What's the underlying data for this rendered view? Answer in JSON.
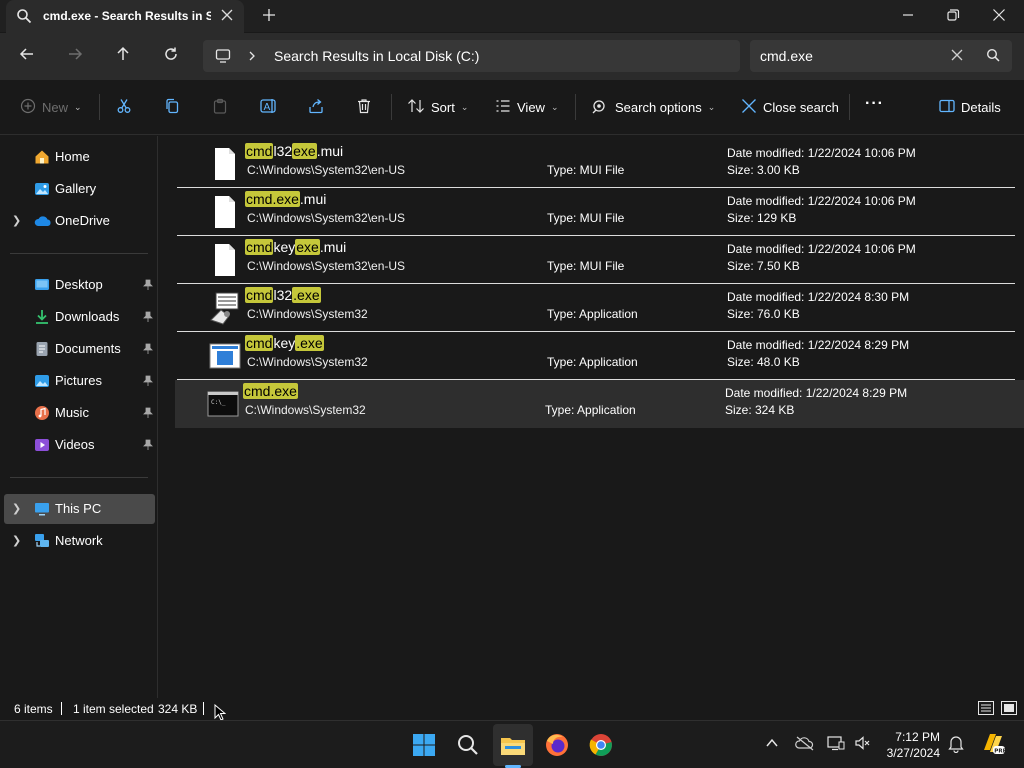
{
  "window": {
    "tab_title": "cmd.exe - Search Results in Sy",
    "controls": [
      "minimize",
      "restore",
      "close"
    ]
  },
  "nav": {
    "breadcrumb_location": "Search Results in Local Disk (C:)",
    "search_value": "cmd.exe"
  },
  "toolbar": {
    "new_label": "New",
    "sort_label": "Sort",
    "view_label": "View",
    "search_options_label": "Search options",
    "close_search_label": "Close search",
    "details_label": "Details"
  },
  "sidebar": {
    "quick": [
      {
        "label": "Home",
        "icon": "home-icon"
      },
      {
        "label": "Gallery",
        "icon": "gallery-icon"
      },
      {
        "label": "OneDrive",
        "icon": "cloud-icon"
      }
    ],
    "pinned": [
      {
        "label": "Desktop",
        "icon": "desktop-icon"
      },
      {
        "label": "Downloads",
        "icon": "download-icon"
      },
      {
        "label": "Documents",
        "icon": "documents-icon"
      },
      {
        "label": "Pictures",
        "icon": "pictures-icon"
      },
      {
        "label": "Music",
        "icon": "music-icon"
      },
      {
        "label": "Videos",
        "icon": "videos-icon"
      }
    ],
    "devices": [
      {
        "label": "This PC",
        "icon": "pc-icon"
      },
      {
        "label": "Network",
        "icon": "network-icon"
      }
    ]
  },
  "results": [
    {
      "name_parts": [
        [
          "cmd",
          true
        ],
        [
          "l32",
          false
        ],
        [
          "exe",
          true
        ],
        [
          ".mui",
          false
        ]
      ],
      "path": "C:\\Windows\\System32\\en-US",
      "type": "Type: MUI File",
      "date": "Date modified: 1/22/2024 10:06 PM",
      "size": "Size: 3.00 KB",
      "icon": "file-icon"
    },
    {
      "name_parts": [
        [
          "cmd.exe",
          true
        ],
        [
          ".mui",
          false
        ]
      ],
      "path": "C:\\Windows\\System32\\en-US",
      "type": "Type: MUI File",
      "date": "Date modified: 1/22/2024 10:06 PM",
      "size": "Size: 129 KB",
      "icon": "file-icon"
    },
    {
      "name_parts": [
        [
          "cmd",
          true
        ],
        [
          "key",
          false
        ],
        [
          "exe",
          true
        ],
        [
          ".mui",
          false
        ]
      ],
      "path": "C:\\Windows\\System32\\en-US",
      "type": "Type: MUI File",
      "date": "Date modified: 1/22/2024 10:06 PM",
      "size": "Size: 7.50 KB",
      "icon": "file-icon"
    },
    {
      "name_parts": [
        [
          "cmd",
          true
        ],
        [
          "l32",
          false
        ],
        [
          ".exe",
          true
        ]
      ],
      "path": "C:\\Windows\\System32",
      "type": "Type: Application",
      "date": "Date modified: 1/22/2024 8:30 PM",
      "size": "Size: 76.0 KB",
      "icon": "cmdl32-app-icon"
    },
    {
      "name_parts": [
        [
          "cmd",
          true
        ],
        [
          "key",
          false
        ],
        [
          ".exe",
          true
        ]
      ],
      "path": "C:\\Windows\\System32",
      "type": "Type: Application",
      "date": "Date modified: 1/22/2024 8:29 PM",
      "size": "Size: 48.0 KB",
      "icon": "cmdkey-app-icon"
    },
    {
      "name_parts": [
        [
          "cmd.exe",
          true
        ]
      ],
      "path": "C:\\Windows\\System32",
      "type": "Type: Application",
      "date": "Date modified: 1/22/2024 8:29 PM",
      "size": "Size: 324 KB",
      "icon": "terminal-icon",
      "selected": true
    }
  ],
  "status": {
    "count": "6 items",
    "selection": "1 item selected",
    "selection_size": "324 KB"
  },
  "taskbar": {
    "time": "7:12 PM",
    "date": "3/27/2024"
  },
  "colors": {
    "highlight": "#c5c73a",
    "accent": "#62b6ff",
    "background": "#191919"
  }
}
